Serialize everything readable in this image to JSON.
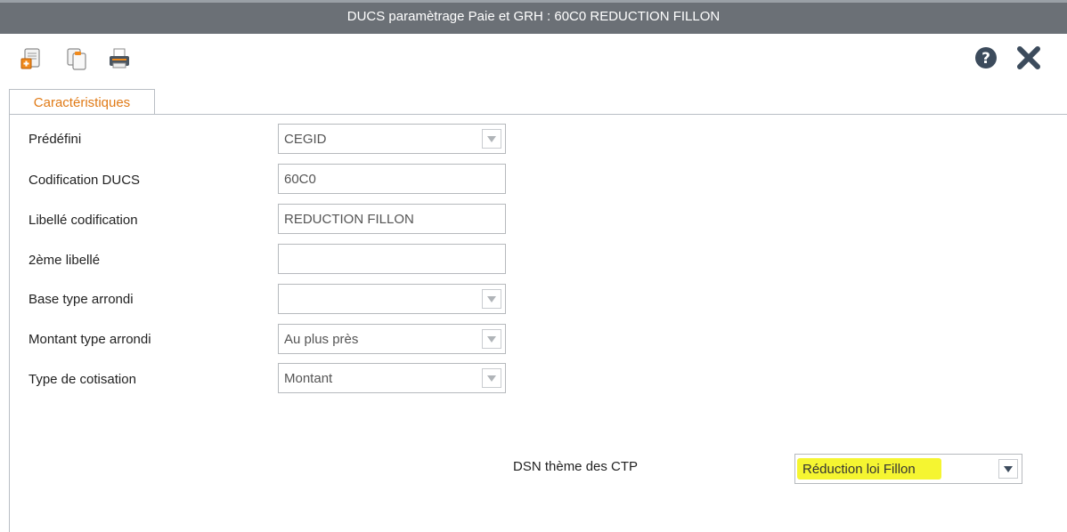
{
  "window": {
    "title": "DUCS paramètrage Paie et GRH : 60C0 REDUCTION FILLON"
  },
  "toolbar": {
    "icons": [
      "new-record-icon",
      "duplicate-icon",
      "print-icon"
    ],
    "right_icons": [
      "help-icon",
      "close-icon"
    ]
  },
  "tabs": [
    {
      "label": "Caractéristiques",
      "active": true
    }
  ],
  "form": {
    "predefini": {
      "label": "Prédéfini",
      "value": "CEGID"
    },
    "codification": {
      "label": "Codification DUCS",
      "value": "60C0"
    },
    "libelle": {
      "label": "Libellé codification",
      "value": "REDUCTION FILLON"
    },
    "libelle2": {
      "label": "2ème libellé",
      "value": ""
    },
    "base_arrondi": {
      "label": "Base type arrondi",
      "value": ""
    },
    "montant_arrondi": {
      "label": "Montant type arrondi",
      "value": "Au plus près"
    },
    "type_cotisation": {
      "label": "Type de cotisation",
      "value": "Montant"
    },
    "dsn_theme": {
      "label": "DSN thème des CTP",
      "value": "Réduction loi Fillon"
    }
  },
  "colors": {
    "title_bar": "#6b7076",
    "tab_text": "#e07a16",
    "highlight": "#f5f531"
  }
}
